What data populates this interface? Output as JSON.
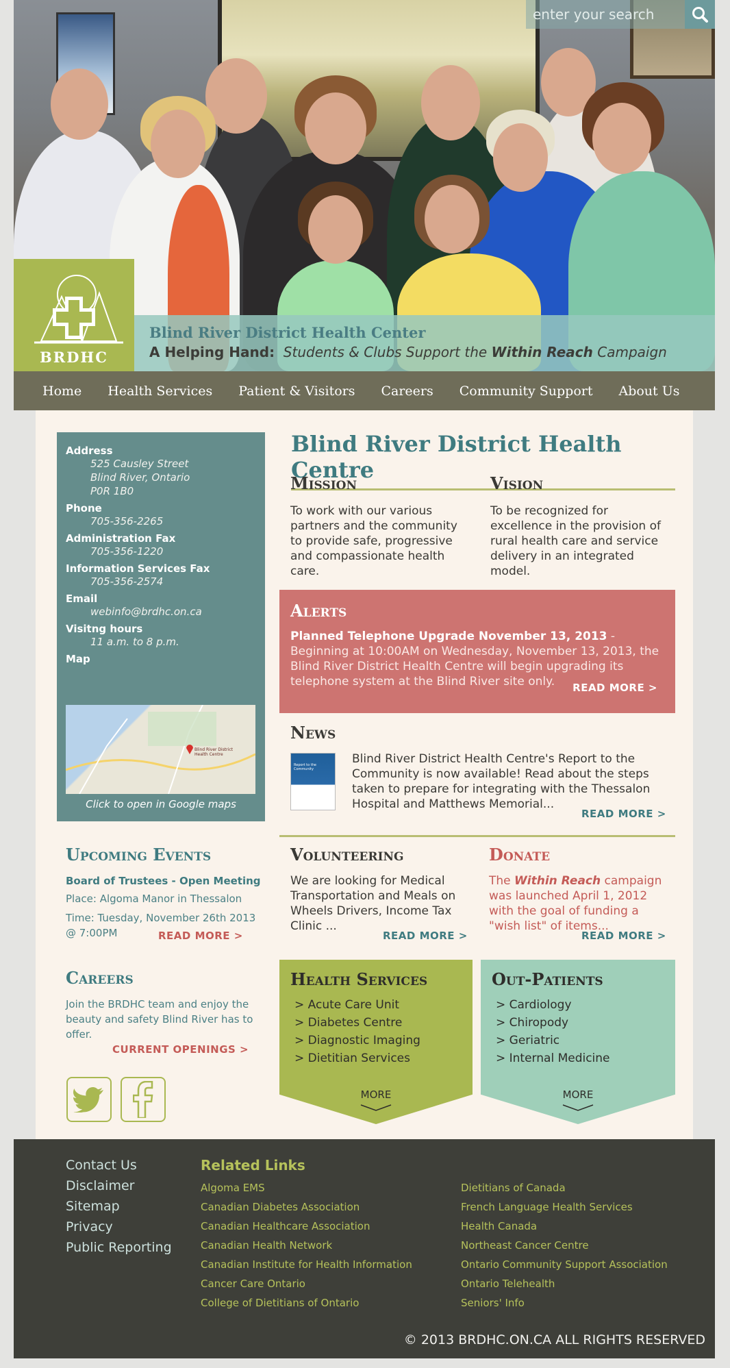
{
  "search": {
    "placeholder": "enter your search"
  },
  "logo": {
    "text": "BRDHC"
  },
  "banner": {
    "title": "Blind River District Health Center",
    "sub_bold": "A Helping Hand:",
    "sub_italic_1": "Students & Clubs Support the",
    "sub_bold_italic": "Within Reach",
    "sub_italic_2": "Campaign"
  },
  "nav": {
    "items": [
      "Home",
      "Health Services",
      "Patient & Visitors",
      "Careers",
      "Community Support",
      "About Us"
    ]
  },
  "contact": {
    "address_label": "Address",
    "address_lines": [
      "525 Causley Street",
      "Blind River, Ontario",
      "P0R 1B0"
    ],
    "phone_label": "Phone",
    "phone": "705-356-2265",
    "admin_fax_label": "Administration Fax",
    "admin_fax": "705-356-1220",
    "is_fax_label": "Information Services Fax",
    "is_fax": "705-356-2574",
    "email_label": "Email",
    "email": "webinfo@brdhc.on.ca",
    "hours_label": "Visitng hours",
    "hours": "11 a.m. to 8 p.m.",
    "map_label": "Map",
    "map_caption": "Click to open in Google maps",
    "map_pin_label": "Blind River District Health Centre"
  },
  "centre": {
    "title": "Blind River District Health Centre",
    "mission_head": "Mission",
    "mission_text": "To work with our various partners and the community to provide safe, progressive and compassionate health care.",
    "vision_head": "Vision",
    "vision_text": "To be recognized for excellence in the provision of rural health care and service delivery in an integrated model."
  },
  "alerts": {
    "head": "Alerts",
    "bold": "Planned Telephone Upgrade November 13, 2013",
    "text": " - Beginning at 10:00AM on Wednesday, November 13, 2013, the Blind River District Health Centre will begin upgrading its telephone system at the Blind River site only.",
    "read_more": "READ MORE >"
  },
  "news": {
    "head": "News",
    "thumb_text": "Report to the Community",
    "text": "Blind River District Health Centre's Report to the Community is now available!  Read about the steps taken to prepare for integrating with the Thessalon Hospital and Matthews Memorial...",
    "read_more": "READ MORE >"
  },
  "events": {
    "head": "Upcoming Events",
    "title": "Board of Trustees - Open Meeting",
    "place": "Place: Algoma Manor in Thessalon",
    "time": "Time: Tuesday, November 26th 2013 @ 7:00PM",
    "read_more": "READ MORE >"
  },
  "volunteering": {
    "head": "Volunteering",
    "text": "We are looking for Medical Transportation and Meals on Wheels Drivers, Income Tax Clinic ...",
    "read_more": "READ MORE >"
  },
  "donate": {
    "head": "Donate",
    "text_1": "The",
    "text_bold": "Within Reach",
    "text_2": "campaign was launched April 1, 2012 with the goal of funding a \"wish list\" of items...",
    "read_more": "READ MORE >"
  },
  "careers": {
    "head": "Careers",
    "text": "Join the BRDHC team and enjoy the beauty and safety Blind River has to offer.",
    "link": "CURRENT OPENINGS >"
  },
  "health_services": {
    "head": "Health Services",
    "items": [
      "> Acute Care Unit",
      "> Diabetes Centre",
      "> Diagnostic Imaging",
      "> Dietitian Services"
    ],
    "more": "MORE"
  },
  "out_patients": {
    "head": "Out-Patients",
    "items": [
      "> Cardiology",
      "> Chiropody",
      "> Geriatric",
      "> Internal Medicine"
    ],
    "more": "MORE"
  },
  "footer": {
    "links": [
      "Contact Us",
      "Disclaimer",
      "Sitemap",
      "Privacy",
      "Public Reporting"
    ],
    "related_head": "Related Links",
    "related_col1": [
      "Algoma EMS",
      "Canadian Diabetes Association",
      "Canadian Healthcare Association",
      "Canadian Health Network",
      "Canadian Institute for Health Information",
      "Cancer Care Ontario",
      "College of Dietitians of Ontario"
    ],
    "related_col2": [
      "Dietitians of Canada",
      "French Language Health Services",
      "Health Canada",
      "Northeast Cancer Centre",
      "Ontario Community Support Association",
      "Ontario Telehealth",
      "Seniors' Info"
    ],
    "copyright": "© 2013 BRDHC.ON.CA ALL RIGHTS RESERVED"
  },
  "colors": {
    "teal": "#658d8c",
    "green": "#a9b851",
    "alert_red": "#cd7471",
    "mint": "#9fcfb9",
    "nav_bg": "#6f6d59",
    "footer_bg": "#3e3f39",
    "cream": "#faf3eb"
  },
  "icons": [
    "search-icon",
    "medical-cross-logo",
    "twitter-icon",
    "facebook-icon",
    "map-pin-icon"
  ]
}
